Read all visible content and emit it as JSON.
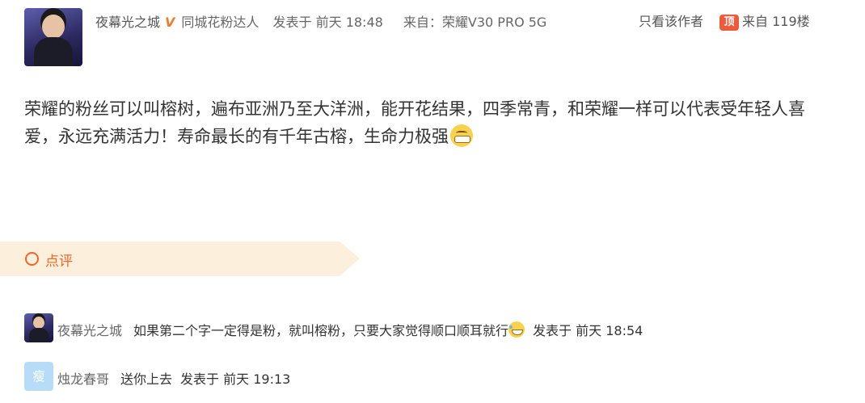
{
  "post": {
    "username": "夜幕光之城",
    "verified_badge": "V",
    "user_title": "同城花粉达人",
    "published": "发表于 前天 18:48",
    "device": "来自：荣耀V30 PRO 5G",
    "only_author": "只看该作者",
    "top_badge": "顶",
    "floor": "来自 119楼",
    "content": "荣耀的粉丝可以叫榕树，遍布亚洲乃至大洋洲，能开花结果，四季常青，和荣耀一样可以代表受年轻人喜爱，永远充满活力！寿命最长的有千年古榕，生命力极强",
    "content_emoji": "grinning-emoji"
  },
  "review": {
    "label": "点评",
    "comments": [
      {
        "name": "夜幕光之城",
        "text": "如果第二个字一定得是粉，就叫榕粉，只要大家觉得顺口顺耳就行",
        "emoji": "laugh-tears-emoji",
        "time": "发表于 前天 18:54"
      },
      {
        "name": "烛龙春哥",
        "avatar_char": "瘦",
        "text": "送你上去",
        "time": "发表于 前天 19:13"
      }
    ]
  },
  "colors": {
    "accent": "#f0662a",
    "review_bg": "#fcefdb",
    "badge": "#f05a3c"
  }
}
